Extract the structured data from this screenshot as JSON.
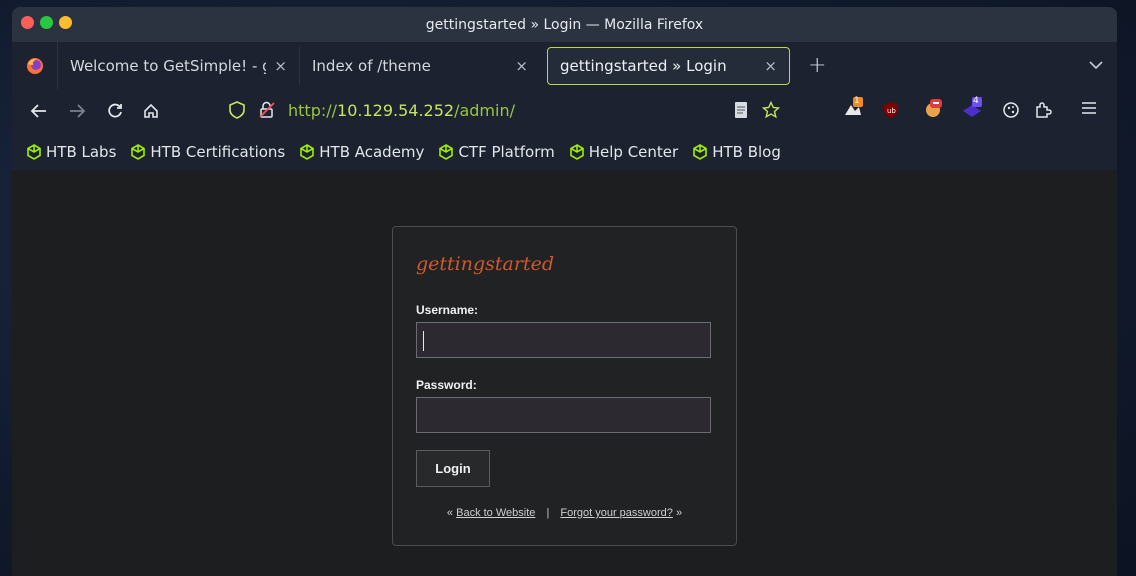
{
  "window": {
    "title": "gettingstarted » Login — Mozilla Firefox"
  },
  "tabs": [
    {
      "label": "Welcome to GetSimple! - getting",
      "close": "×"
    },
    {
      "label": "Index of /theme",
      "close": "×"
    },
    {
      "label": "gettingstarted » Login",
      "close": "×",
      "active": true
    }
  ],
  "newtab": "+",
  "address": {
    "scheme": "http://",
    "host": "10.129.54.252",
    "path": "/admin/"
  },
  "extensions": {
    "badge1": "1",
    "badge2": "4"
  },
  "bookmarks": [
    "HTB Labs",
    "HTB Certifications",
    "HTB Academy",
    "CTF Platform",
    "Help Center",
    "HTB Blog"
  ],
  "login": {
    "site_name": "gettingstarted",
    "username_label": "Username:",
    "username_value": "",
    "password_label": "Password:",
    "password_value": "",
    "submit_label": "Login",
    "prefix": "«",
    "back_link": "Back to Website",
    "separator": "|",
    "forgot_link": "Forgot your password?",
    "suffix": "»"
  },
  "colors": {
    "accent": "#b9d84a",
    "site_name": "#d0582a",
    "bookmark_icon": "#9fef00"
  }
}
